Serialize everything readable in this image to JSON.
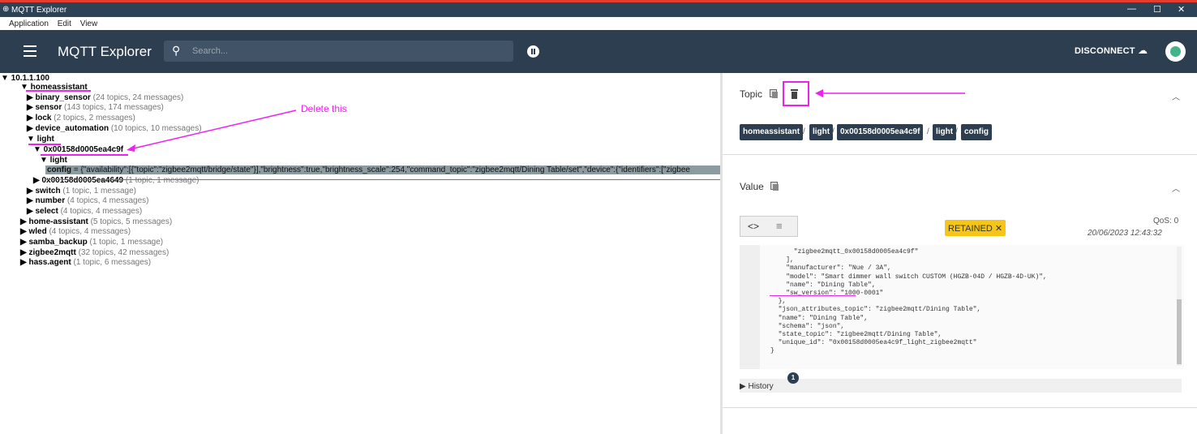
{
  "window": {
    "title": "MQTT Explorer",
    "controls": [
      "—",
      "☐",
      "✕"
    ]
  },
  "menu": [
    "Application",
    "Edit",
    "View"
  ],
  "appbar": {
    "title": "MQTT Explorer",
    "search_placeholder": "Search...",
    "disconnect_label": "DISCONNECT"
  },
  "tree": {
    "root": "▼ 10.1.1.100",
    "nodes": [
      {
        "label": "▼ homeassistant",
        "meta": ""
      },
      {
        "label": "▶ binary_sensor",
        "meta": " (24 topics, 24 messages)"
      },
      {
        "label": "▶ sensor",
        "meta": " (143 topics, 174 messages)"
      },
      {
        "label": "▶ lock",
        "meta": " (2 topics, 2 messages)"
      },
      {
        "label": "▶ device_automation",
        "meta": " (10 topics, 10 messages)"
      },
      {
        "label": "▼ light",
        "meta": ""
      },
      {
        "label": "▼ 0x00158d0005ea4c9f",
        "meta": ""
      },
      {
        "label": "▼ light",
        "meta": ""
      },
      {
        "label": "config",
        "meta": " = {\"availability\":[{\"topic\":\"zigbee2mqtt/bridge/state\"}],\"brightness\":true,\"brightness_scale\":254,\"command_topic\":\"zigbee2mqtt/Dining Table/set\",\"device\":{\"identifiers\":[\"zigbee"
      },
      {
        "label": "▶ 0x00158d0005ea4649",
        "meta": " (1 topic, 1 message)"
      },
      {
        "label": "▶ switch",
        "meta": " (1 topic, 1 message)"
      },
      {
        "label": "▶ number",
        "meta": " (4 topics, 4 messages)"
      },
      {
        "label": "▶ select",
        "meta": " (4 topics, 4 messages)"
      },
      {
        "label": "▶ home-assistant",
        "meta": " (5 topics, 5 messages)"
      },
      {
        "label": "▶ wled",
        "meta": " (4 topics, 4 messages)"
      },
      {
        "label": "▶ samba_backup",
        "meta": " (1 topic, 1 message)"
      },
      {
        "label": "▶ zigbee2mqtt",
        "meta": " (32 topics, 42 messages)"
      },
      {
        "label": "▶ hass.agent",
        "meta": " (1 topic, 6 messages)"
      }
    ]
  },
  "annotation": {
    "delete_text": "Delete this"
  },
  "details": {
    "topic_label": "Topic",
    "breadcrumbs": [
      "homeassistant",
      "light",
      "0x00158d0005ea4c9f",
      "light",
      "config"
    ],
    "value_label": "Value",
    "retained_label": "RETAINED ✕",
    "qos": "QoS: 0",
    "timestamp": "20/06/2023 12:43:32",
    "code_lines": [
      "      \"zigbee2mqtt_0x00158d0005ea4c9f\"",
      "    ],",
      "    \"manufacturer\": \"Nue / 3A\",",
      "    \"model\": \"Smart dimmer wall switch CUSTOM (HGZB-04D / HGZB-4D-UK)\",",
      "    \"name\": \"Dining Table\",",
      "    \"sw_version\": \"1000-0001\"",
      "  },",
      "  \"json_attributes_topic\": \"zigbee2mqtt/Dining Table\",",
      "  \"name\": \"Dining Table\",",
      "  \"schema\": \"json\",",
      "  \"state_topic\": \"zigbee2mqtt/Dining Table\",",
      "  \"unique_id\": \"0x00158d0005ea4c9f_light_zigbee2mqtt\"",
      "}"
    ],
    "history_label": "▶ History",
    "history_count": "1"
  }
}
